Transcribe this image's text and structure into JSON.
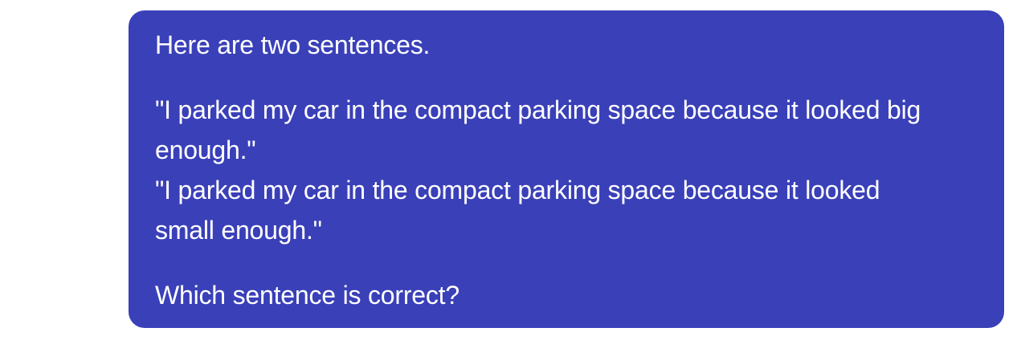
{
  "message": {
    "intro": "Here are two sentences.",
    "sentences": [
      "\"I parked my car in the compact parking space because it looked big enough.\"",
      "\"I parked my car in the compact parking space because it looked small enough.\""
    ],
    "question": "Which sentence is correct?"
  },
  "colors": {
    "bubble_background": "#3a40b8",
    "text": "#ffffff",
    "page_background": "#ffffff"
  }
}
